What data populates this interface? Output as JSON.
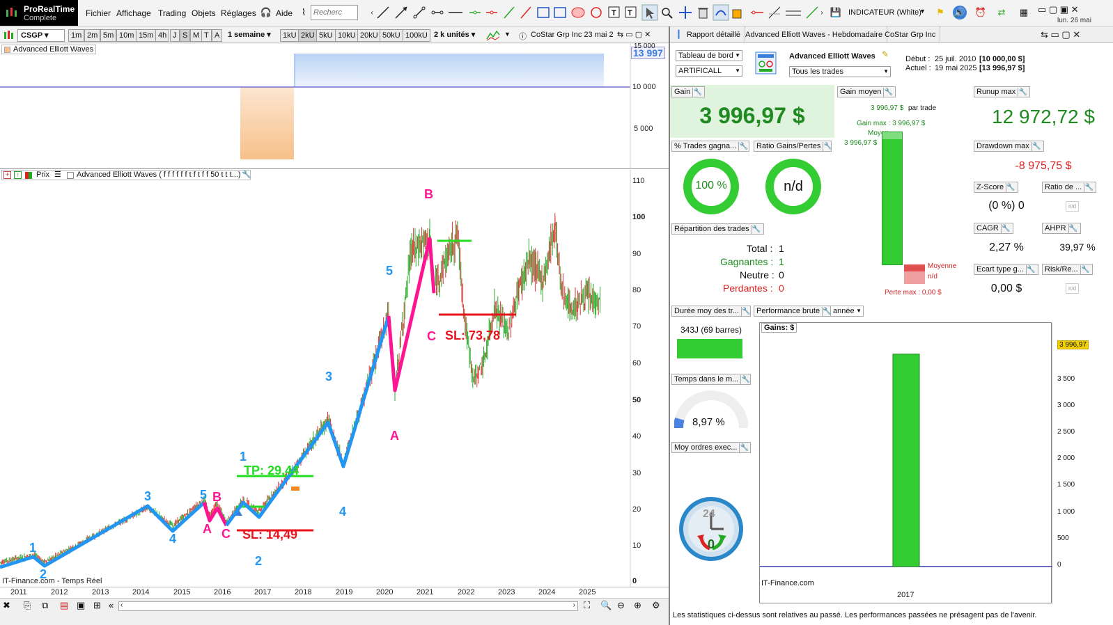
{
  "app": {
    "logo_line1": "ProRealTime",
    "logo_line2": "Complete"
  },
  "menu": [
    "Fichier",
    "Affichage",
    "Trading",
    "Objets",
    "Réglages",
    "Aide"
  ],
  "search": {
    "placeholder": "Recherc"
  },
  "indicator_select": "INDICATEUR (White)",
  "clock": "lun. 26 mai",
  "toolbar": {
    "symbol": "CSGP",
    "timeframes": [
      "1m",
      "2m",
      "5m",
      "10m",
      "15m",
      "4h",
      "J",
      "S",
      "M",
      "T",
      "A"
    ],
    "period": "1 semaine",
    "ticks": [
      "1kU",
      "2kU",
      "5kU",
      "10kU",
      "20kU",
      "50kU",
      "100kU"
    ],
    "units": "2 k unités",
    "instrument_label": "CoStar Grp Inc 23 mai 2"
  },
  "upper_panel": {
    "title": "Advanced Elliott Waves",
    "value_badge": "13 997",
    "y_ticks": [
      "15 000",
      "10 000",
      "5 000"
    ]
  },
  "main_chart": {
    "legend_prefix": "Prix",
    "legend_text": "Advanced Elliott Waves ( f f f f f f t f t f f 50 t t t...)",
    "watermark": "IT-Finance.com - Temps Réel",
    "y_ticks": [
      "110",
      "100",
      "90",
      "80",
      "70",
      "60",
      "50",
      "40",
      "30",
      "20",
      "10",
      "0"
    ],
    "x_ticks": [
      "2011",
      "2012",
      "2013",
      "2014",
      "2015",
      "2016",
      "2017",
      "2018",
      "2019",
      "2020",
      "2021",
      "2022",
      "2023",
      "2024",
      "2025"
    ],
    "labels": {
      "tp": "TP: 29,44",
      "sl_low": "SL: 14,49",
      "sl_high": "SL: 73,78",
      "waves_blue": [
        "1",
        "2",
        "3",
        "4",
        "5",
        "1",
        "2",
        "3",
        "4",
        "5"
      ],
      "waves_pink": [
        "A",
        "B",
        "C",
        "A",
        "B",
        "C"
      ]
    },
    "colors": {
      "impulse": "#2196F3",
      "corrective": "#FF1493",
      "tp": "#22DD22",
      "sl": "#E8141E"
    }
  },
  "right_panel": {
    "tabs": [
      "Rapport détaillé",
      "Advanced Elliott Waves - Hebdomadaire",
      "CoStar Grp Inc"
    ],
    "dropdowns": {
      "dashboard": "Tableau de bord",
      "mode": "ARTIFICALL",
      "trades": "Tous les trades"
    },
    "strategy_name": "Advanced Elliott Waves",
    "start_label": "Début :",
    "start_value": "25 juil. 2010",
    "start_amount": "[10 000,00 $]",
    "current_label": "Actuel :",
    "current_value": "19 mai 2025",
    "current_amount": "[13 996,97 $]",
    "gain": {
      "label": "Gain",
      "value": "3 996,97 $"
    },
    "gain_moyen": {
      "label": "Gain moyen",
      "per_trade_value": "3 996,97 $",
      "per_trade_suffix": "par trade",
      "gain_max": "Gain max : 3 996,97 $",
      "moyen_label": "Moyen",
      "moyen_value": "3 996,97 $",
      "moyenne_label": "Moyenne",
      "moyenne_value": "n/d",
      "perte_max": "Perte max : 0,00 $"
    },
    "runup_max": {
      "label": "Runup max",
      "value": "12 972,72 $"
    },
    "pct_trades": {
      "label": "% Trades gagna...",
      "value": "100 %",
      "fraction": 1.0
    },
    "ratio_gains": {
      "label": "Ratio Gains/Pertes",
      "value": "n/d"
    },
    "drawdown_max": {
      "label": "Drawdown max",
      "value": "-8 975,75 $"
    },
    "zscore": {
      "label": "Z-Score",
      "value": "(0 %) 0"
    },
    "ratio_de": {
      "label": "Ratio de ...",
      "value": "n/d"
    },
    "repartition": {
      "label": "Répartition des trades",
      "total_label": "Total :",
      "total": "1",
      "gagnantes_label": "Gagnantes :",
      "gagnantes": "1",
      "neutre_label": "Neutre :",
      "neutre": "0",
      "perdantes_label": "Perdantes :",
      "perdantes": "0"
    },
    "cagr": {
      "label": "CAGR",
      "value": "2,27 %"
    },
    "ahpr": {
      "label": "AHPR",
      "value": "39,97 %"
    },
    "ecart_type": {
      "label": "Ecart type g...",
      "value": "0,00 $"
    },
    "risk_re": {
      "label": "Risk/Re...",
      "value": "n/d"
    },
    "duree": {
      "label": "Durée moy des tr...",
      "value": "343J (69 barres)"
    },
    "perf_brute": {
      "label": "Performance brute",
      "period": "année"
    },
    "temps_marche": {
      "label": "Temps dans le m...",
      "value": "8,97 %",
      "fraction": 0.0897
    },
    "moy_ordres": {
      "label": "Moy ordres exec..."
    },
    "clock_widget": {
      "top": "24",
      "bottom": "0"
    },
    "footer": "Les statistiques ci-dessus sont relatives au passé. Les performances passées ne présagent pas de l'avenir.",
    "gains_chart_title": "Gains: $",
    "gains_chart_watermark": "IT-Finance.com"
  },
  "chart_data": {
    "type": "bar",
    "title": "Gains: $",
    "categories": [
      "2017"
    ],
    "values": [
      3996.97
    ],
    "value_label": "3 996,97",
    "y_ticks": [
      "3 500",
      "3 000",
      "2 500",
      "2 000",
      "1 500",
      "1 000",
      "500",
      "0"
    ],
    "ylim": [
      0,
      4400
    ],
    "color": "#33CC33"
  }
}
